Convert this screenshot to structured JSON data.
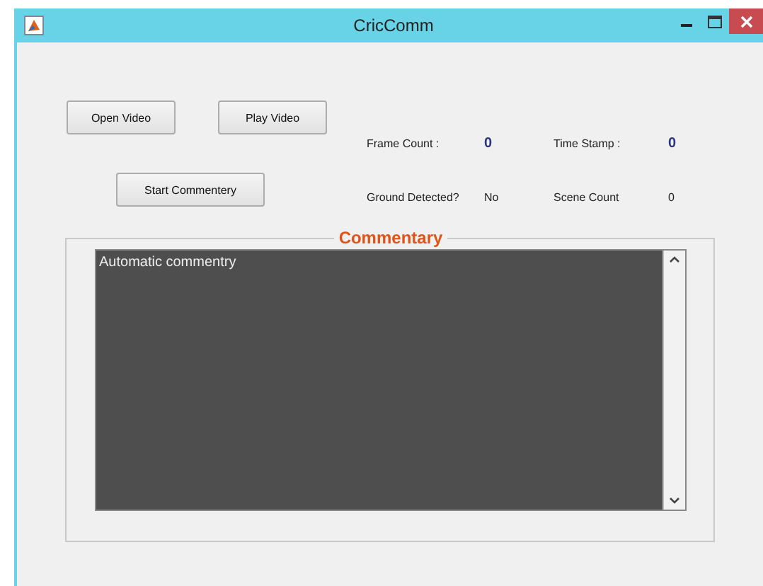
{
  "window": {
    "title": "CricComm"
  },
  "buttons": [
    {
      "label": "Open Video"
    },
    {
      "label": "Play Video"
    },
    {
      "label": "Start Commentery"
    }
  ],
  "fields": [
    {
      "label": "Frame Count :",
      "value": "0",
      "kind": "counter"
    },
    {
      "label": "Time Stamp :",
      "value": "0",
      "kind": "counter"
    },
    {
      "label": "Ground Detected?",
      "value": "No",
      "kind": "plain"
    },
    {
      "label": "Scene Count",
      "value": "0",
      "kind": "plain"
    }
  ],
  "commentary": {
    "title": "Commentary",
    "text": "Automatic commentry"
  }
}
